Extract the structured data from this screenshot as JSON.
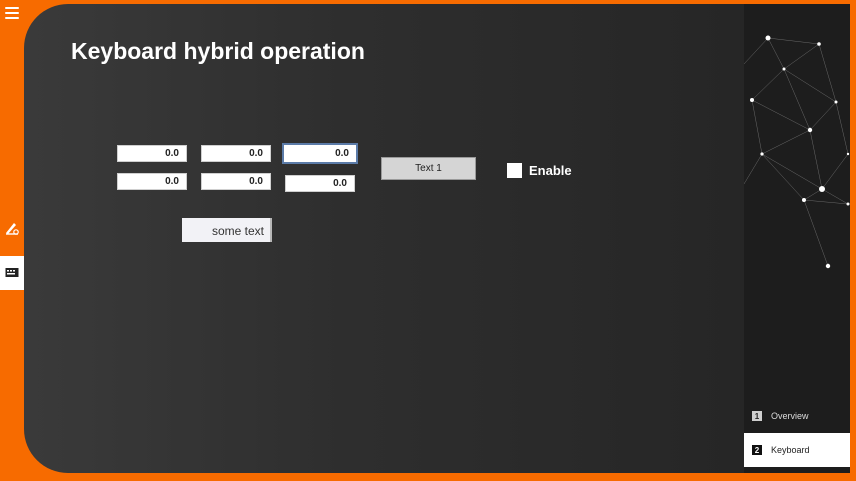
{
  "page": {
    "title": "Keyboard hybrid operation"
  },
  "fields": {
    "row1": [
      "0.0",
      "0.0",
      "0.0"
    ],
    "row2": [
      "0.0",
      "0.0",
      "0.0"
    ]
  },
  "button": {
    "label": "Text 1"
  },
  "checkbox": {
    "label": "Enable",
    "checked": false
  },
  "text_field": {
    "value": "some text"
  },
  "nav": {
    "items": [
      {
        "number": "1",
        "label": "Overview",
        "active": false
      },
      {
        "number": "2",
        "label": "Keyboard",
        "active": true
      }
    ]
  },
  "sidebar": {
    "icons": [
      "menu-icon",
      "pen-settings-icon",
      "keyboard-panel-icon"
    ]
  },
  "colors": {
    "accent": "#f76b00",
    "panel": "#2e2e2e"
  }
}
